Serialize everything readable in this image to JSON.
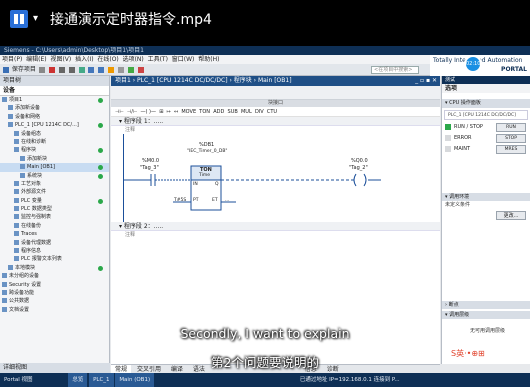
{
  "player": {
    "file_name": "接通演示定时器指令.mp4",
    "chevron": "▾"
  },
  "app": {
    "title_text": "Siemens - C:\\Users\\admin\\Desktop\\项目1\\项目1",
    "menu_items": [
      "项目(P)",
      "编辑(E)",
      "视图(V)",
      "插入(I)",
      "在线(O)",
      "选项(N)",
      "工具(T)",
      "窗口(W)",
      "帮助(H)"
    ],
    "toolbar_text": "保存项目",
    "search_placeholder": "<在项目中搜索>",
    "tia_brand": "Totally Integrated Automation",
    "tia_sub": "PORTAL",
    "rec_badge": "02:10"
  },
  "left_panel": {
    "header": "项目树",
    "devices_label": "设备",
    "tree": [
      {
        "label": "项目1",
        "ok": true
      },
      {
        "label": "添加新设备",
        "ok": false
      },
      {
        "label": "设备和网络",
        "ok": false
      },
      {
        "label": "PLC_1 [CPU 1214C DC/...]",
        "ok": true
      },
      {
        "label": "设备组态",
        "ok": false
      },
      {
        "label": "在线和诊断",
        "ok": false
      },
      {
        "label": "程序块",
        "ok": true
      },
      {
        "label": "添加新块",
        "ok": false
      },
      {
        "label": "Main [OB1]",
        "ok": true,
        "selected": true
      },
      {
        "label": "系统块",
        "ok": true
      },
      {
        "label": "工艺对象",
        "ok": false
      },
      {
        "label": "外部源文件",
        "ok": false
      },
      {
        "label": "PLC 变量",
        "ok": true
      },
      {
        "label": "PLC 数据类型",
        "ok": false
      },
      {
        "label": "监控与强制表",
        "ok": false
      },
      {
        "label": "在线备份",
        "ok": false
      },
      {
        "label": "Traces",
        "ok": false
      },
      {
        "label": "设备代理数据",
        "ok": false
      },
      {
        "label": "程序信息",
        "ok": false
      },
      {
        "label": "PLC 报警文本列表",
        "ok": false
      },
      {
        "label": "本地模块",
        "ok": true
      },
      {
        "label": "未分组的设备",
        "ok": false
      },
      {
        "label": "Security 设置",
        "ok": false
      },
      {
        "label": "跨设备功能",
        "ok": false
      },
      {
        "label": "公共数据",
        "ok": false
      },
      {
        "label": "文档设置",
        "ok": false
      }
    ],
    "footer": "详细视图"
  },
  "editor": {
    "breadcrumb": "项目1 › PLC_1 [CPU 1214C DC/DC/DC] › 程序块 › Main [OB1]",
    "interface_label": "块接口",
    "network1_title": "程序段 1：.....",
    "network1_comment": "注释",
    "network2_title": "程序段 2：.....",
    "network2_comment": "注释",
    "timer": {
      "db_label": "%DB1",
      "db_name": "\"IEC_Timer_0_DB\"",
      "type": "TON",
      "sub": "Time",
      "in_pin": "IN",
      "q_pin": "Q",
      "pt_pin": "PT",
      "et_pin": "ET",
      "pt_value": "T#5S",
      "et_value": "..."
    },
    "contact": {
      "address": "%M0.0",
      "tag": "\"Tag_3\""
    },
    "coil": {
      "address": "%Q0.0",
      "tag": "\"Tag_2\""
    }
  },
  "bottom": {
    "tabs": [
      "常规",
      "交叉引用",
      "编译",
      "语法"
    ],
    "info_tab": "信息",
    "diag_tab": "诊断"
  },
  "right_panel": {
    "header": "测试",
    "options_label": "选项",
    "cpu_panel": "CPU 操作面板",
    "cpu_name": "PLC_1 [CPU 1214C DC/DC/DC]",
    "run_stop": "RUN / STOP",
    "run_btn": "RUN",
    "error": "ERROR",
    "stop_btn": "STOP",
    "maint": "MAINT",
    "mres_btn": "MRES",
    "call_env": "调用环境",
    "cond_label": "未定义条件",
    "change_btn": "更改...",
    "breakpoints": "断点",
    "call_hier": "调用层级",
    "no_call": "无可用调用层级"
  },
  "taskbar": {
    "portal": "Portal 视图",
    "overview": "总览",
    "plc": "PLC_1",
    "main": "Main (OB1)",
    "status": "已通过地址 IP=192.168.0.1 连接到 P..."
  },
  "subtitles": {
    "english": "Secondly, I want to explain",
    "chinese": "第2个问题要说明的"
  },
  "watermark": "S英·•⊕⊞"
}
